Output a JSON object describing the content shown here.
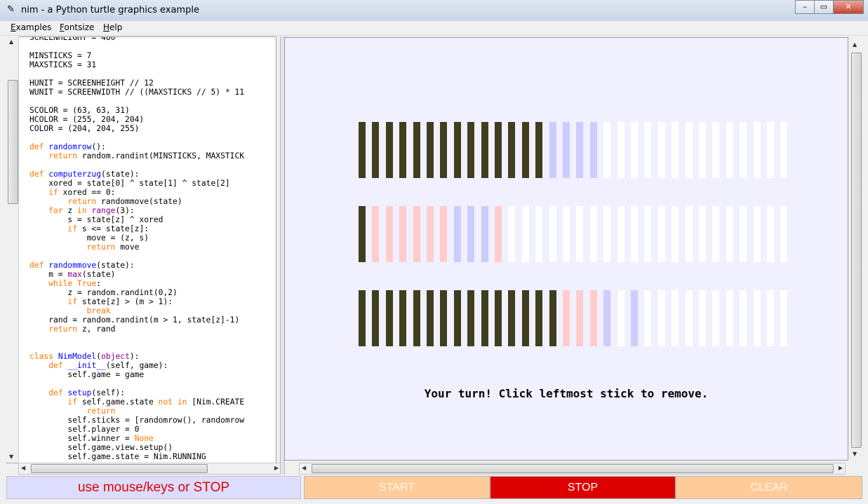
{
  "window": {
    "title": "nim - a Python turtle graphics example",
    "buttons": [
      "–",
      "▭",
      "✕"
    ]
  },
  "menu": [
    {
      "label": "Examples",
      "u": "E",
      "rest": "xamples"
    },
    {
      "label": "Fontsize",
      "u": "F",
      "rest": "ontsize"
    },
    {
      "label": "Help",
      "u": "H",
      "rest": "elp"
    }
  ],
  "code_html": "SCREENHEIGHT = 480\n\nMINSTICKS = 7\nMAXSTICKS = 31\n\nHUNIT = SCREENHEIGHT // 12\nWUNIT = SCREENWIDTH // ((MAXSTICKS // 5) * 11\n\nSCOLOR = (63, 63, 31)\nHCOLOR = (255, 204, 204)\nCOLOR = (204, 204, 255)\n\n<span class=\"kw\">def</span> <span class=\"fn\">randomrow</span>():\n    <span class=\"kw\">return</span> random.randint(MINSTICKS, MAXSTICK\n\n<span class=\"kw\">def</span> <span class=\"fn\">computerzug</span>(state):\n    xored = state[0] ^ state[1] ^ state[2]\n    <span class=\"kw\">if</span> xored == 0:\n        <span class=\"kw\">return</span> randommove(state)\n    <span class=\"kw\">for</span> z <span class=\"kw\">in</span> <span class=\"bi\">range</span>(3):\n        s = state[z] ^ xored\n        <span class=\"kw\">if</span> s &lt;= state[z]:\n            move = (z, s)\n            <span class=\"kw\">return</span> move\n\n<span class=\"kw\">def</span> <span class=\"fn\">randommove</span>(state):\n    m = <span class=\"bi\">max</span>(state)\n    <span class=\"kw\">while</span> <span class=\"kw\">True</span>:\n        z = random.randint(0,2)\n        <span class=\"kw\">if</span> state[z] &gt; (m &gt; 1):\n            <span class=\"kw\">break</span>\n    rand = random.randint(m &gt; 1, state[z]-1)\n    <span class=\"kw\">return</span> z, rand\n\n\n<span class=\"kw\">class</span> <span class=\"fn\">NimModel</span>(<span class=\"bi\">object</span>):\n    <span class=\"kw\">def</span> <span class=\"fn\">__init__</span>(self, game):\n        self.game = game\n\n    <span class=\"kw\">def</span> <span class=\"fn\">setup</span>(self):\n        <span class=\"kw\">if</span> self.game.state <span class=\"kw\">not</span> <span class=\"kw\">in</span> [Nim.CREATE\n            <span class=\"kw\">return</span>\n        self.sticks = [randomrow(), randomrow\n        self.player = 0\n        self.winner = <span class=\"kw\">None</span>\n        self.game.view.setup()\n        self.game.state = Nim.RUNNING",
  "game": {
    "colors": {
      "S": "#3f3f1f",
      "H": "#ffcccc",
      "C": "#ccccff",
      "W": "#ffffff"
    },
    "rows": [
      "SSSSSSSSSSSSSSCCCCWWWWWWWWWWWWWW",
      "SHHHHHHCCCHWWWWWWWWWWWWWWWWWWWWW",
      "SSSSSSSSSSSSSSSHHHCWCWWWWWWWWWWW"
    ],
    "message": "Your turn! Click leftmost stick to remove."
  },
  "status": "use mouse/keys or STOP",
  "buttons": {
    "start": "START",
    "stop": "STOP",
    "clear": "CLEAR"
  }
}
